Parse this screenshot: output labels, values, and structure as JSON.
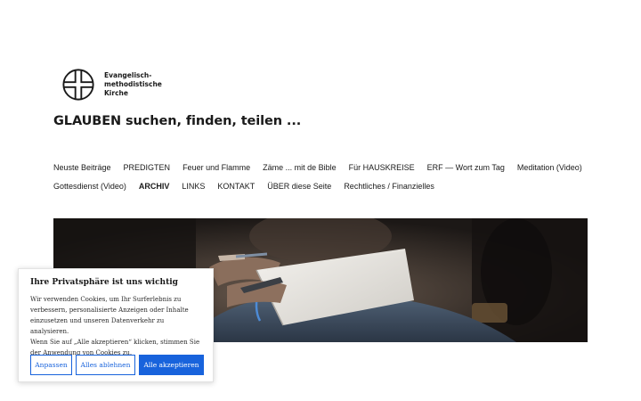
{
  "logo": {
    "lines": [
      "Evangelisch-",
      "methodistische",
      "Kirche"
    ]
  },
  "site": {
    "title": "GLAUBEN suchen, finden, teilen ..."
  },
  "nav": {
    "row1": [
      {
        "label": "Neuste Beiträge"
      },
      {
        "label": "PREDIGTEN"
      },
      {
        "label": "Feuer und Flamme"
      },
      {
        "label": "Zäme ... mit de Bible"
      },
      {
        "label": "Für HAUSKREISE"
      },
      {
        "label": "ERF — Wort zum Tag"
      },
      {
        "label": "Meditation (Video)"
      }
    ],
    "row2": [
      {
        "label": "Gottesdienst (Video)"
      },
      {
        "label": "ARCHIV",
        "active": true
      },
      {
        "label": "LINKS"
      },
      {
        "label": "KONTAKT"
      },
      {
        "label": "ÜBER diese Seite"
      },
      {
        "label": "Rechtliches / Finanzielles"
      }
    ]
  },
  "cookie": {
    "title": "Ihre Privatsphäre ist uns wichtig",
    "lines": [
      "Wir verwenden Cookies, um Ihr Surferlebnis zu",
      "verbessern, personalisierte Anzeigen oder Inhalte",
      "einzusetzen und unseren Datenverkehr zu analysieren.",
      "Wenn Sie auf „Alle akzeptieren“ klicken, stimmen Sie",
      "der Anwendung von Cookies zu."
    ],
    "customize_label": "Anpassen",
    "reject_label": "Alles ablehnen",
    "accept_label": "Alle akzeptieren",
    "accent_color": "#1863dc"
  }
}
